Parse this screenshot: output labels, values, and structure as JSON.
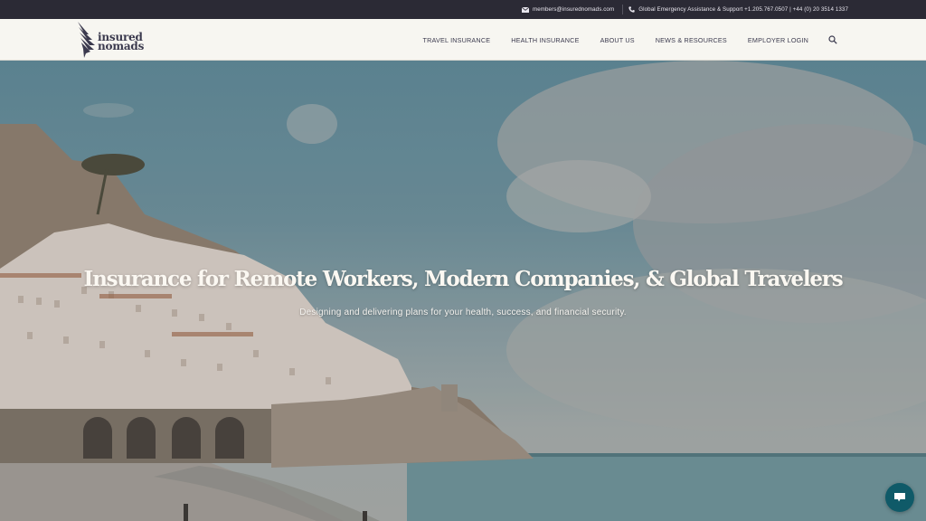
{
  "topbar": {
    "email": "members@insurednomads.com",
    "support_text": "Global Emergency Assistance & Support +1.205.767.0507 | +44 (0) 20 3514 1337"
  },
  "header": {
    "logo_line1": "insured",
    "logo_line2": "nomads",
    "nav": [
      {
        "label": "TRAVEL INSURANCE"
      },
      {
        "label": "HEALTH INSURANCE"
      },
      {
        "label": "ABOUT US"
      },
      {
        "label": "NEWS & RESOURCES"
      },
      {
        "label": "EMPLOYER LOGIN"
      }
    ]
  },
  "hero": {
    "title": "Insurance for Remote Workers, Modern Companies, & Global Travelers",
    "subtitle": "Designing and delivering plans for your health, success, and financial security."
  },
  "colors": {
    "topbar_bg": "#2b2a35",
    "header_bg": "#f7f6f1",
    "brand_dark": "#3b3a4e",
    "chat_button": "#0f5a68"
  }
}
